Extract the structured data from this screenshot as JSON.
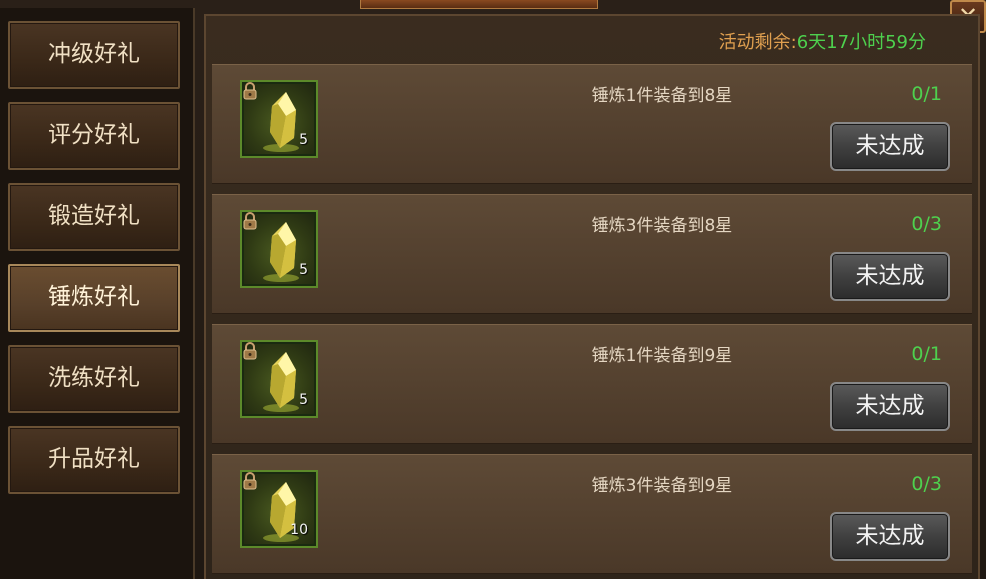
{
  "close_label": "✕",
  "sidebar": {
    "tabs": [
      {
        "label": "冲级好礼"
      },
      {
        "label": "评分好礼"
      },
      {
        "label": "锻造好礼"
      },
      {
        "label": "锤炼好礼"
      },
      {
        "label": "洗练好礼"
      },
      {
        "label": "升品好礼"
      }
    ],
    "active_index": 3
  },
  "timer": {
    "label": "活动剩余:",
    "value": "6天17小时59分"
  },
  "tasks": [
    {
      "title": "锤炼1件装备到8星",
      "progress": "0/1",
      "reward_count": "5",
      "status": "未达成"
    },
    {
      "title": "锤炼3件装备到8星",
      "progress": "0/3",
      "reward_count": "5",
      "status": "未达成"
    },
    {
      "title": "锤炼1件装备到9星",
      "progress": "0/1",
      "reward_count": "5",
      "status": "未达成"
    },
    {
      "title": "锤炼3件装备到9星",
      "progress": "0/3",
      "reward_count": "10",
      "status": "未达成"
    }
  ],
  "colors": {
    "progress": "#4ed14e",
    "timer_label": "#e0a050"
  }
}
